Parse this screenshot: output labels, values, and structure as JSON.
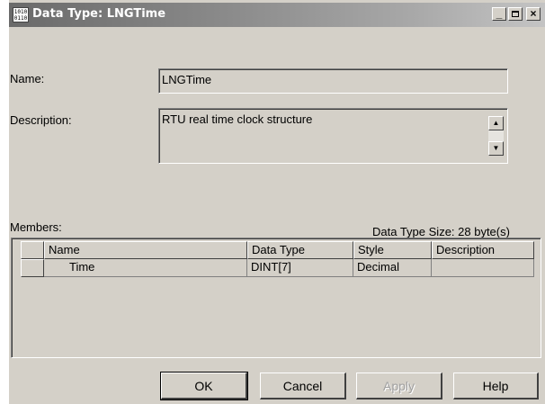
{
  "window": {
    "title": "Data Type: LNGTime",
    "icon_text": "1010\n0110",
    "minimize_icon": "minimize-icon",
    "maximize_icon": "maximize-icon",
    "close_icon": "close-icon"
  },
  "form": {
    "name_label": "Name:",
    "name_value": "LNGTime",
    "description_label": "Description:",
    "description_value": "RTU real time clock structure",
    "members_label": "Members:",
    "size_label": "Data Type Size: 28 byte(s)"
  },
  "members": {
    "columns": [
      "Name",
      "Data Type",
      "Style",
      "Description"
    ],
    "rows": [
      {
        "name": "Time",
        "data_type": "DINT[7]",
        "style": "Decimal",
        "description": ""
      }
    ]
  },
  "buttons": {
    "ok": "OK",
    "cancel": "Cancel",
    "apply": "Apply",
    "help": "Help"
  },
  "colors": {
    "face": "#d4d0c8",
    "title_gradient_start": "#6a6a6a",
    "title_gradient_end": "#c4c4c4"
  }
}
